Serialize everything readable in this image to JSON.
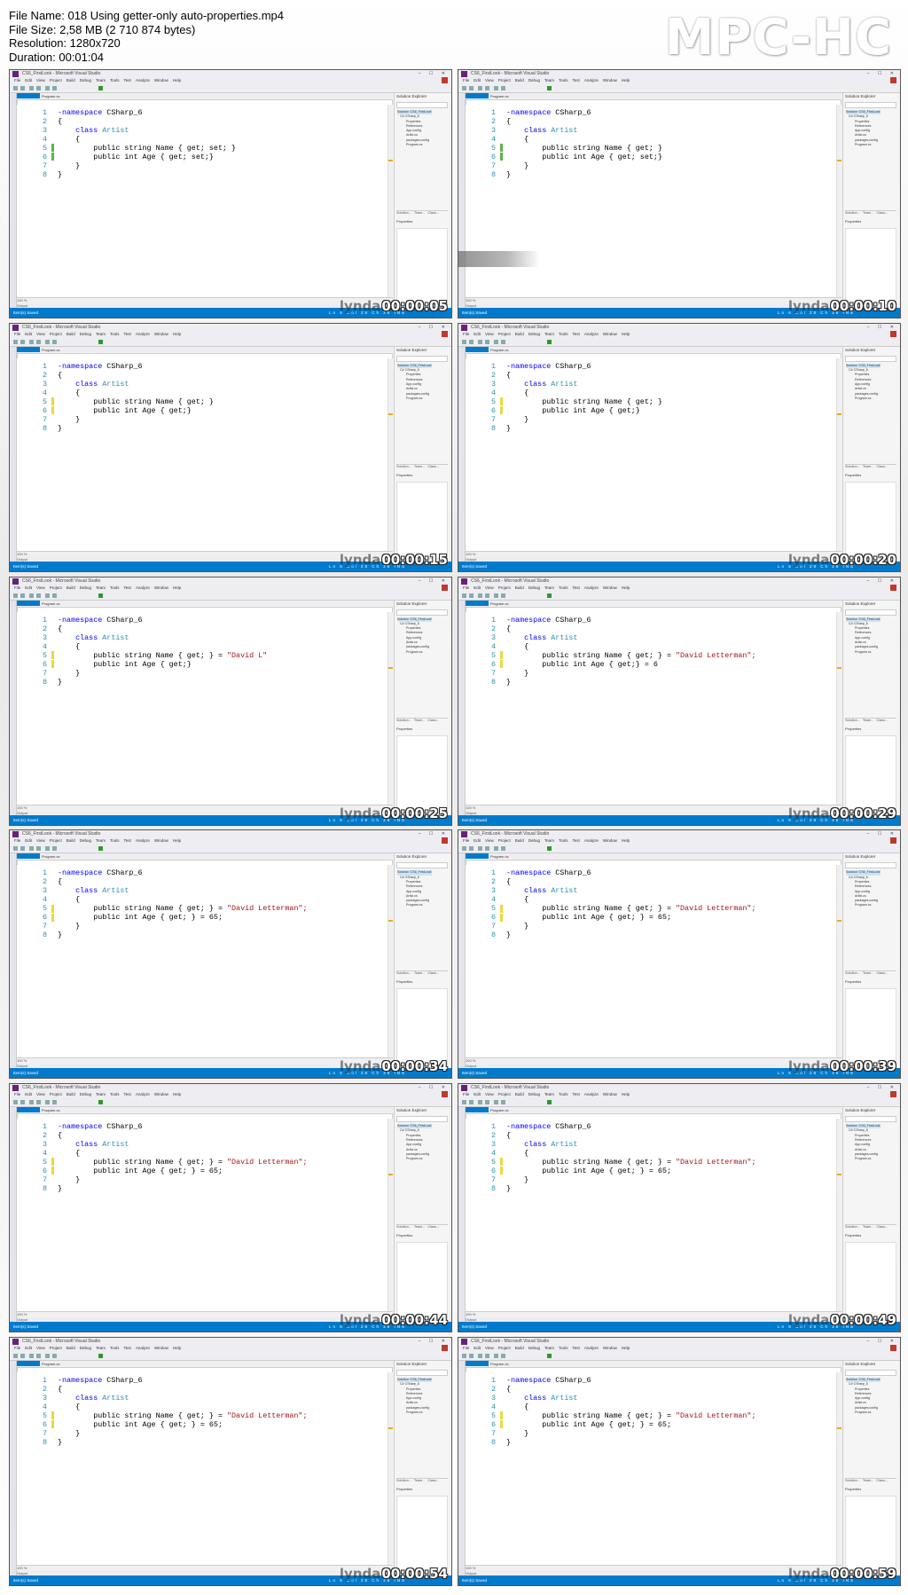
{
  "header": {
    "file_name": "File Name: 018 Using getter-only auto-properties.mp4",
    "file_size": "File Size: 2,58 MB (2 710 874 bytes)",
    "resolution": "Resolution: 1280x720",
    "duration": "Duration: 00:01:04",
    "player_logo": "MPC-HC"
  },
  "common": {
    "window_title": "CS6_FirstLook - Microsoft Visual Studio",
    "menu": [
      "File",
      "Edit",
      "View",
      "Project",
      "Build",
      "Debug",
      "Team",
      "Tools",
      "Test",
      "Analyze",
      "Window",
      "Help"
    ],
    "doc_tab_inactive": "Program.cs",
    "solution_explorer_title": "Solution Explorer",
    "solution_tree": [
      "Solution 'CS6_FirstLook'",
      "C# CSharp_6",
      "Properties",
      "References",
      "App.config",
      "Artist.cs",
      "packages.config",
      "Program.cs"
    ],
    "se_tabs": [
      "Solution...",
      "Team...",
      "Class..."
    ],
    "properties_title": "Properties",
    "zoom": "100 %",
    "output_tab": "Output",
    "status_left": "Item(s) Saved",
    "status_mid": "Ln 6 Col 28 Ch 28 INS",
    "watermark": "lynda"
  },
  "thumbnails": [
    {
      "time": "00:00:05",
      "l5": "public string Name { get; set; }",
      "l6": "public int Age { get; set;}",
      "l5_str": "",
      "l6_tail": "",
      "marker": "g"
    },
    {
      "time": "00:00:10",
      "l5": "public string Name { get; }",
      "l6": "public int Age { get; set;}",
      "l5_str": "",
      "l6_tail": "",
      "marker": "g",
      "drag": true
    },
    {
      "time": "00:00:15",
      "l5": "public string Name { get; }",
      "l6": "public int Age { get;}",
      "l5_str": "",
      "l6_tail": "",
      "marker": "y"
    },
    {
      "time": "00:00:20",
      "l5": "public string Name { get; }",
      "l6": "public int Age { get;}",
      "l5_str": "",
      "l6_tail": "",
      "marker": "y"
    },
    {
      "time": "00:00:25",
      "l5": "public string Name { get; } = ",
      "l6": "public int Age { get;}",
      "l5_str": "\"David L\"",
      "l6_tail": "",
      "marker": "y"
    },
    {
      "time": "00:00:29",
      "l5": "public string Name { get; } = ",
      "l6": "public int Age { get;} = 6",
      "l5_str": "\"David Letterman\";",
      "l6_tail": "",
      "marker": "y"
    },
    {
      "time": "00:00:34",
      "l5": "public string Name { get; } = ",
      "l6": "public int Age { get; } = 65;",
      "l5_str": "\"David Letterman\";",
      "l6_tail": "",
      "marker": "y"
    },
    {
      "time": "00:00:39",
      "l5": "public string Name { get; } = ",
      "l6": "public int Age { get; } = 65;",
      "l5_str": "\"David Letterman\";",
      "l6_tail": "",
      "marker": "y"
    },
    {
      "time": "00:00:44",
      "l5": "public string Name { get; } = ",
      "l6": "public int Age { get; } = 65;",
      "l5_str": "\"David Letterman\";",
      "l6_tail": "",
      "marker": "y"
    },
    {
      "time": "00:00:49",
      "l5": "public string Name { get; } = ",
      "l6": "public int Age { get; } = 65;",
      "l5_str": "\"David Letterman\";",
      "l6_tail": "",
      "marker": "y"
    },
    {
      "time": "00:00:54",
      "l5": "public string Name { get; } = ",
      "l6": "public int Age { get; } = 65;",
      "l5_str": "\"David Letterman\";",
      "l6_tail": "",
      "marker": "y"
    },
    {
      "time": "00:00:59",
      "l5": "public string Name { get; } = ",
      "l6": "public int Age { get; } = 65;",
      "l5_str": "\"David Letterman\";",
      "l6_tail": "",
      "marker": "y"
    }
  ],
  "code_common": {
    "l1": "namespace CSharp_6",
    "l2": "{",
    "l3": "class Artist",
    "l4": "{",
    "l7": "}",
    "l8": "}"
  }
}
